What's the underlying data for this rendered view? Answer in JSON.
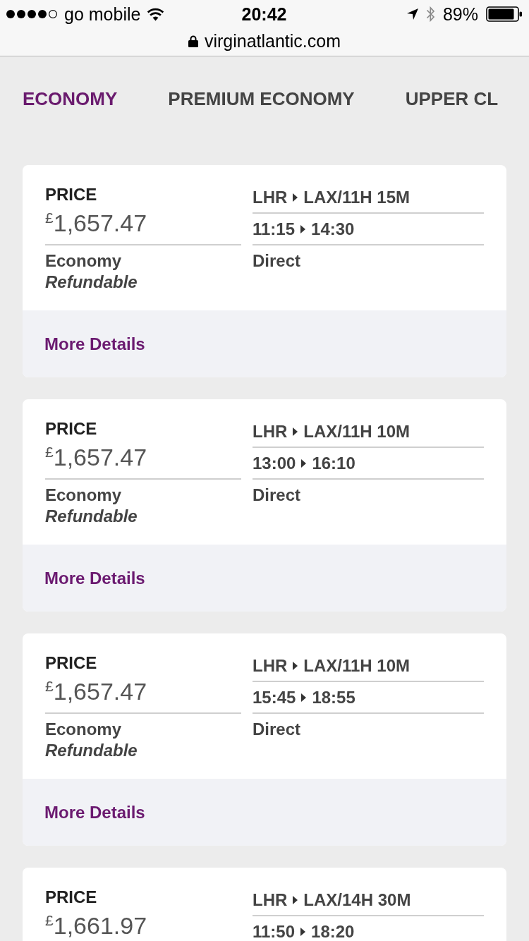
{
  "status_bar": {
    "carrier": "go mobile",
    "time": "20:42",
    "battery": "89%"
  },
  "address_bar": {
    "url": "virginatlantic.com"
  },
  "cabin_tabs": [
    {
      "label": "ECONOMY",
      "selected": true
    },
    {
      "label": "PREMIUM ECONOMY",
      "selected": false
    },
    {
      "label": "UPPER CL",
      "selected": false
    }
  ],
  "flights": [
    {
      "price_label": "PRICE",
      "price": "$^{£}$1,657.47",
      "fare": "Economy",
      "refund": "Refundable",
      "origin": "LHR",
      "destination": "LAX/11H 15M",
      "depart": "11:15",
      "arrive": "14:30",
      "stops": "Direct",
      "link": "More Details"
    },
    {
      "price_label": "PRICE",
      "price": "$^{£}$1,657.47",
      "fare": "Economy",
      "refund": "Refundable",
      "origin": "LHR",
      "destination": "LAX/11H 10M",
      "depart": "13:00",
      "arrive": "16:10",
      "stops": "Direct",
      "link": "More Details"
    },
    {
      "price_label": "PRICE",
      "price": "$^{£}$1,657.47",
      "fare": "Economy",
      "refund": "Refundable",
      "origin": "LHR",
      "destination": "LAX/11H 10M",
      "depart": "15:45",
      "arrive": "18:55",
      "stops": "Direct",
      "link": "More Details"
    },
    {
      "price_label": "PRICE",
      "price": "$^{£}$1,661.97",
      "origin": "LHR",
      "destination": "LAX/14H 30M",
      "depart": "11:50",
      "arrive": "18:20"
    }
  ]
}
